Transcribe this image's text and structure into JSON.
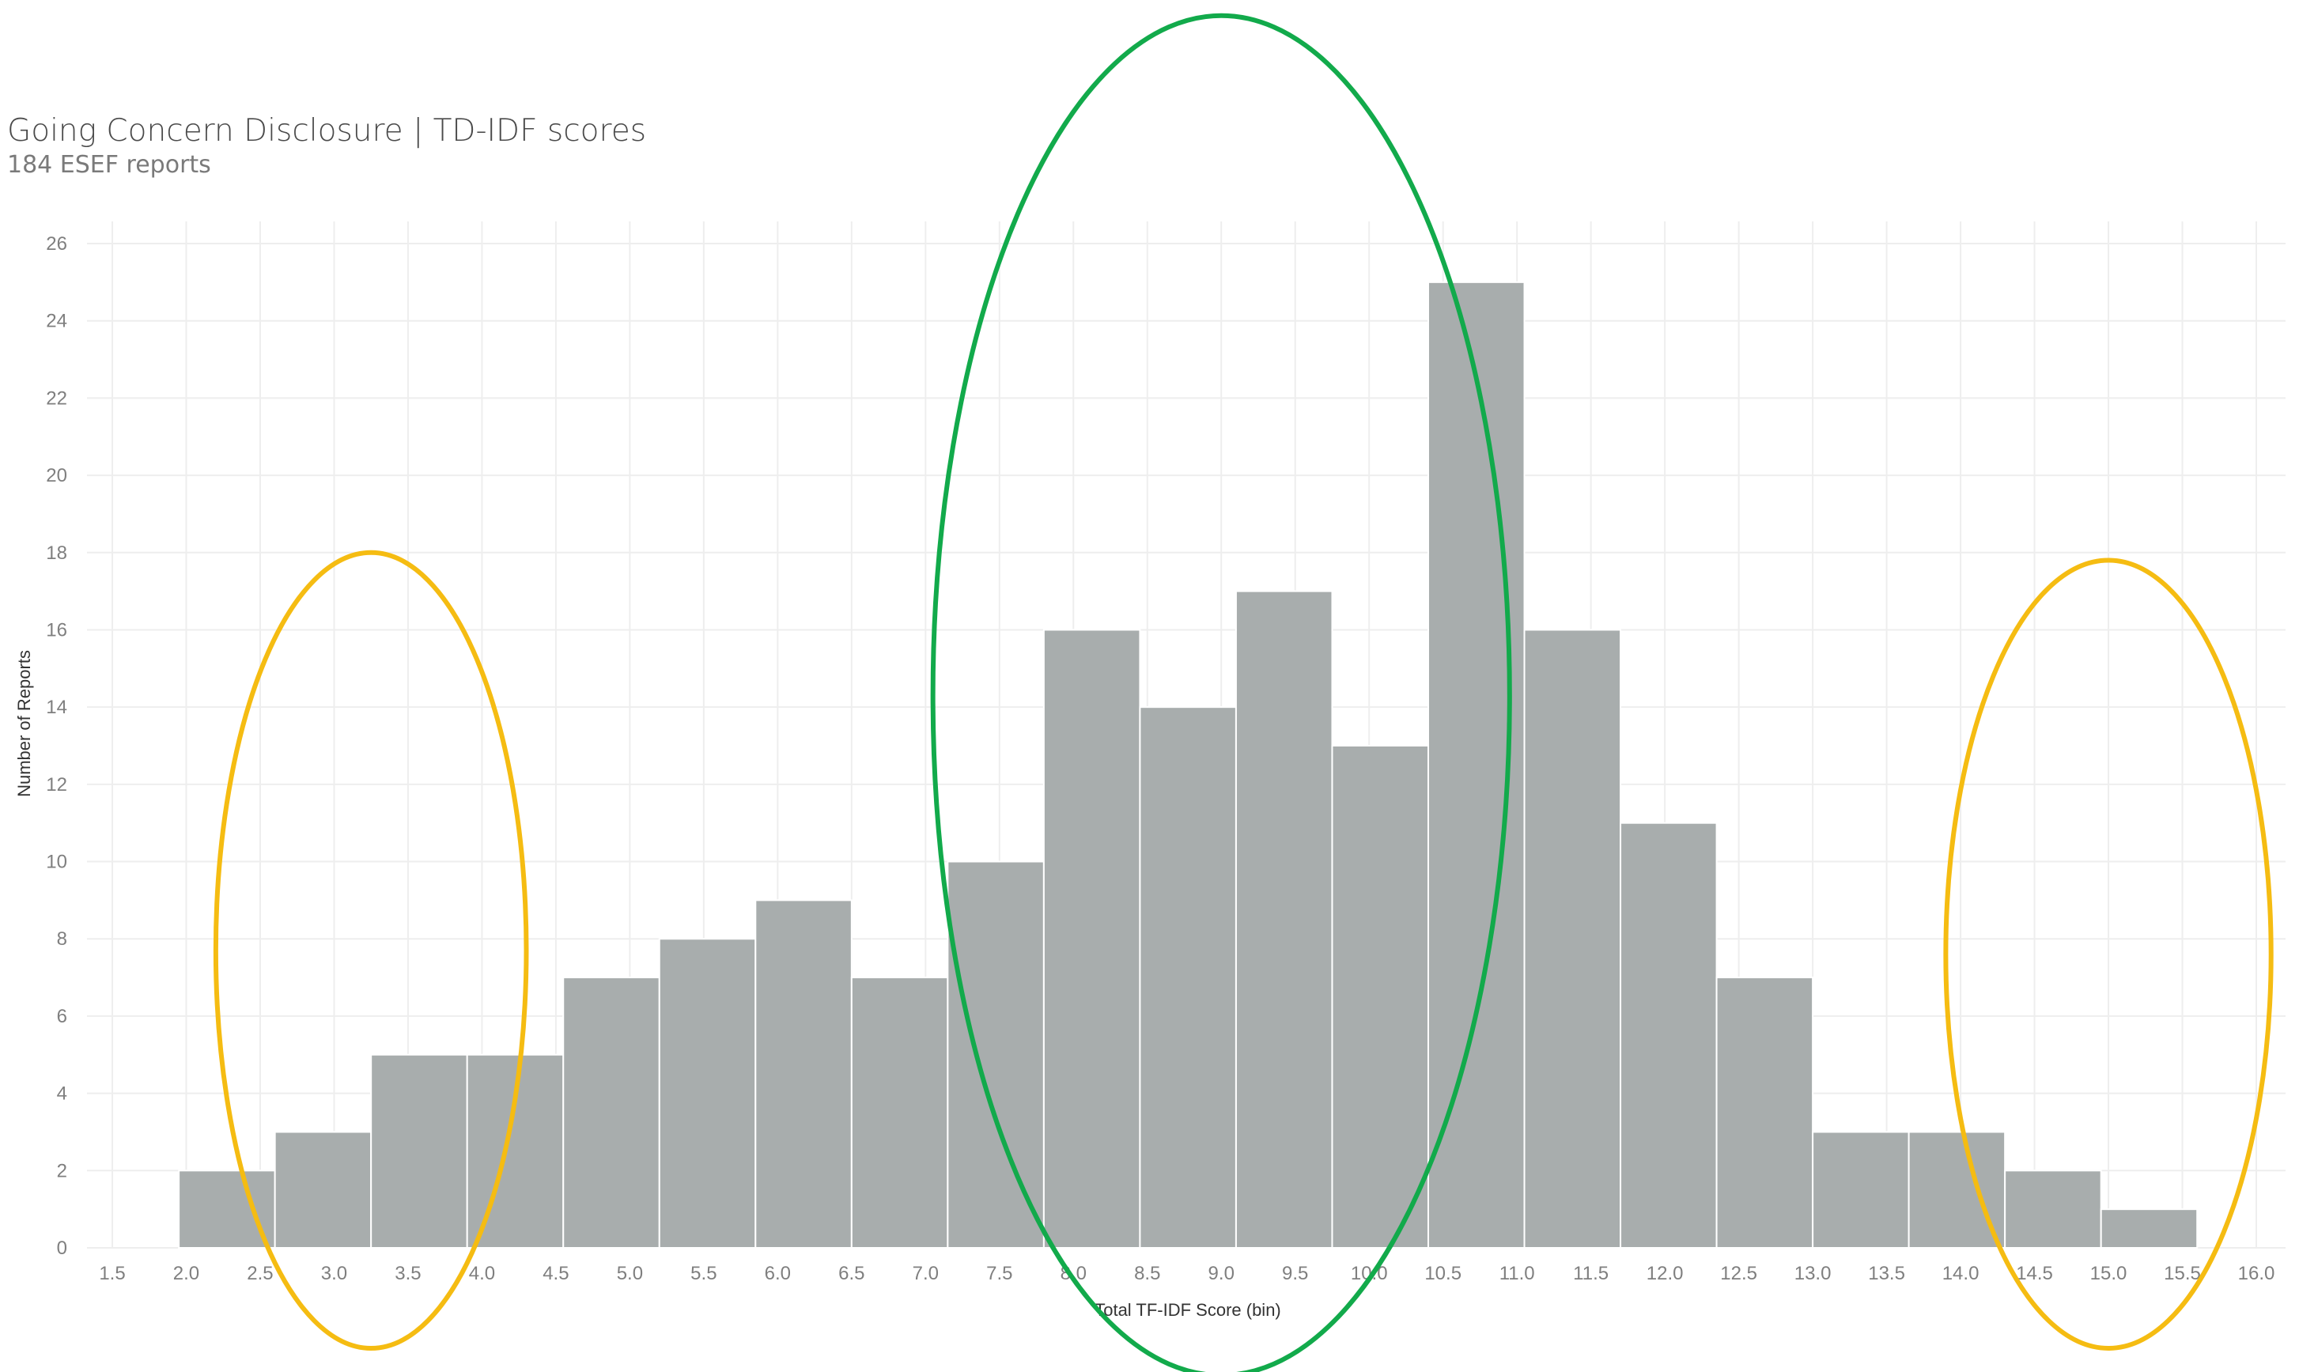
{
  "chart_data": {
    "type": "bar",
    "title": "Going Concern Disclosure | TD-IDF scores",
    "subtitle": "184 ESEF reports",
    "xlabel": "Total TF-IDF Score (bin)",
    "ylabel": "Number of Reports",
    "bin_width": 0.65,
    "bins": [
      {
        "start": 1.95,
        "end": 2.6,
        "value": 2
      },
      {
        "start": 2.6,
        "end": 3.25,
        "value": 3
      },
      {
        "start": 3.25,
        "end": 3.9,
        "value": 5
      },
      {
        "start": 3.9,
        "end": 4.55,
        "value": 5
      },
      {
        "start": 4.55,
        "end": 5.2,
        "value": 7
      },
      {
        "start": 5.2,
        "end": 5.85,
        "value": 8
      },
      {
        "start": 5.85,
        "end": 6.5,
        "value": 9
      },
      {
        "start": 6.5,
        "end": 7.15,
        "value": 7
      },
      {
        "start": 7.15,
        "end": 7.8,
        "value": 10
      },
      {
        "start": 7.8,
        "end": 8.45,
        "value": 16
      },
      {
        "start": 8.45,
        "end": 9.1,
        "value": 14
      },
      {
        "start": 9.1,
        "end": 9.75,
        "value": 17
      },
      {
        "start": 9.75,
        "end": 10.4,
        "value": 13
      },
      {
        "start": 10.4,
        "end": 11.05,
        "value": 25
      },
      {
        "start": 11.05,
        "end": 11.7,
        "value": 16
      },
      {
        "start": 11.7,
        "end": 12.35,
        "value": 11
      },
      {
        "start": 12.35,
        "end": 13.0,
        "value": 7
      },
      {
        "start": 13.0,
        "end": 13.65,
        "value": 3
      },
      {
        "start": 13.65,
        "end": 14.3,
        "value": 3
      },
      {
        "start": 14.3,
        "end": 14.95,
        "value": 2
      },
      {
        "start": 14.95,
        "end": 15.6,
        "value": 1
      }
    ],
    "xlim": [
      1.5,
      16.0
    ],
    "ylim": [
      0,
      26
    ],
    "x_ticks": [
      "1.5",
      "2.0",
      "2.5",
      "3.0",
      "3.5",
      "4.0",
      "4.5",
      "5.0",
      "5.5",
      "6.0",
      "6.5",
      "7.0",
      "7.5",
      "8.0",
      "8.5",
      "9.0",
      "9.5",
      "10.0",
      "10.5",
      "11.0",
      "11.5",
      "12.0",
      "12.5",
      "13.0",
      "13.5",
      "14.0",
      "14.5",
      "15.0",
      "15.5",
      "16.0"
    ],
    "y_ticks": [
      0,
      2,
      4,
      6,
      8,
      10,
      12,
      14,
      16,
      18,
      20,
      22,
      24,
      26
    ],
    "grid": true,
    "colors": {
      "bar": "#a8adad",
      "bar_edge": "#ffffff",
      "grid": "#eeeeee",
      "highlight_left": "#f5bc12",
      "highlight_center": "#12aa4b",
      "highlight_right": "#f5bc12"
    },
    "highlights": [
      {
        "name": "low-tail",
        "color": "highlight_left",
        "x_from": 2.2,
        "x_to": 4.3,
        "y_from": -2.6,
        "y_to": 18.0
      },
      {
        "name": "central-peak",
        "color": "highlight_center",
        "x_from": 7.05,
        "x_to": 10.95,
        "y_from": -3.3,
        "y_to": 31.9
      },
      {
        "name": "high-tail",
        "color": "highlight_right",
        "x_from": 13.9,
        "x_to": 16.1,
        "y_from": -2.6,
        "y_to": 17.8
      }
    ]
  }
}
